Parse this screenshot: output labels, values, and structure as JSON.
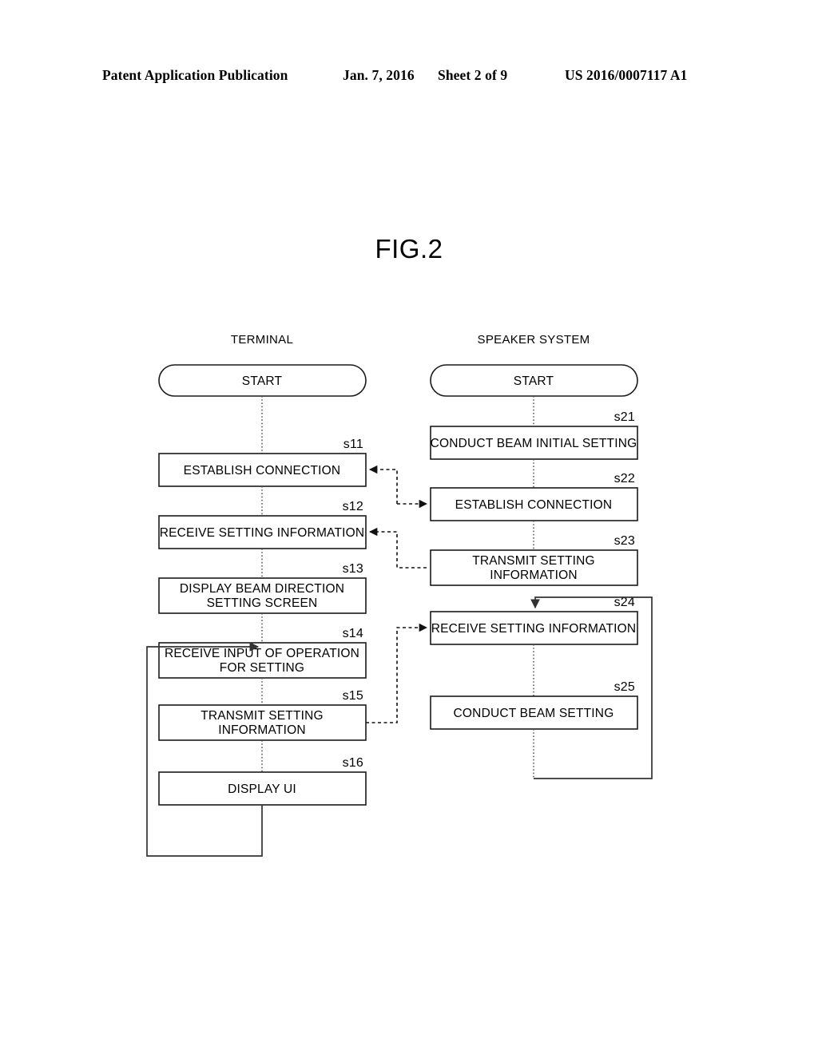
{
  "header": {
    "publication": "Patent Application Publication",
    "date": "Jan. 7, 2016",
    "sheet": "Sheet 2 of 9",
    "patent_number": "US 2016/0007117 A1"
  },
  "figure": {
    "title": "FIG.2",
    "columns": [
      {
        "id": "terminal",
        "label": "TERMINAL"
      },
      {
        "id": "speaker-system",
        "label": "SPEAKER SYSTEM"
      }
    ],
    "terminal_nodes": [
      {
        "id": "start-left",
        "shape": "terminator",
        "label": "START",
        "step": ""
      },
      {
        "id": "s11",
        "shape": "process",
        "label": "ESTABLISH CONNECTION",
        "step": "s11"
      },
      {
        "id": "s12",
        "shape": "process",
        "label": "RECEIVE SETTING INFORMATION",
        "step": "s12"
      },
      {
        "id": "s13",
        "shape": "process",
        "label": "DISPLAY BEAM DIRECTION\nSETTING SCREEN",
        "line1": "DISPLAY BEAM DIRECTION",
        "line2": "SETTING SCREEN",
        "step": "s13"
      },
      {
        "id": "s14",
        "shape": "process",
        "label": "RECEIVE INPUT OF OPERATION\nFOR SETTING",
        "line1": "RECEIVE INPUT OF OPERATION",
        "line2": "FOR SETTING",
        "step": "s14"
      },
      {
        "id": "s15",
        "shape": "process",
        "label": "TRANSMIT SETTING\nINFORMATION",
        "line1": "TRANSMIT SETTING",
        "line2": "INFORMATION",
        "step": "s15"
      },
      {
        "id": "s16",
        "shape": "process",
        "label": "DISPLAY UI",
        "step": "s16"
      }
    ],
    "speaker_nodes": [
      {
        "id": "start-right",
        "shape": "terminator",
        "label": "START",
        "step": ""
      },
      {
        "id": "s21",
        "shape": "process",
        "label": "CONDUCT BEAM INITIAL SETTING",
        "step": "s21"
      },
      {
        "id": "s22",
        "shape": "process",
        "label": "ESTABLISH CONNECTION",
        "step": "s22"
      },
      {
        "id": "s23",
        "shape": "process",
        "label": "TRANSMIT SETTING\nINFORMATION",
        "line1": "TRANSMIT SETTING",
        "line2": "INFORMATION",
        "step": "s23"
      },
      {
        "id": "s24",
        "shape": "process",
        "label": "RECEIVE SETTING INFORMATION",
        "step": "s24"
      },
      {
        "id": "s25",
        "shape": "process",
        "label": "CONDUCT BEAM SETTING",
        "step": "s25"
      }
    ],
    "message_flows": [
      {
        "id": "s22-to-s11",
        "from": "s22",
        "to": "s11",
        "style": "dashed"
      },
      {
        "id": "s11-to-s22",
        "from": "s11",
        "to": "s22",
        "style": "dashed"
      },
      {
        "id": "s23-to-s12",
        "from": "s23",
        "to": "s12",
        "style": "dashed"
      },
      {
        "id": "s15-to-s24",
        "from": "s15",
        "to": "s24",
        "style": "dashed"
      }
    ],
    "loops": [
      {
        "id": "terminal-loop",
        "from": "s16",
        "to": "s14"
      },
      {
        "id": "speaker-loop",
        "from": "s25",
        "to": "s24"
      }
    ],
    "colors": {
      "ink": "#000000",
      "box_stroke": "#1a1a1a",
      "flow_line": "#555555",
      "paper": "#ffffff"
    }
  }
}
